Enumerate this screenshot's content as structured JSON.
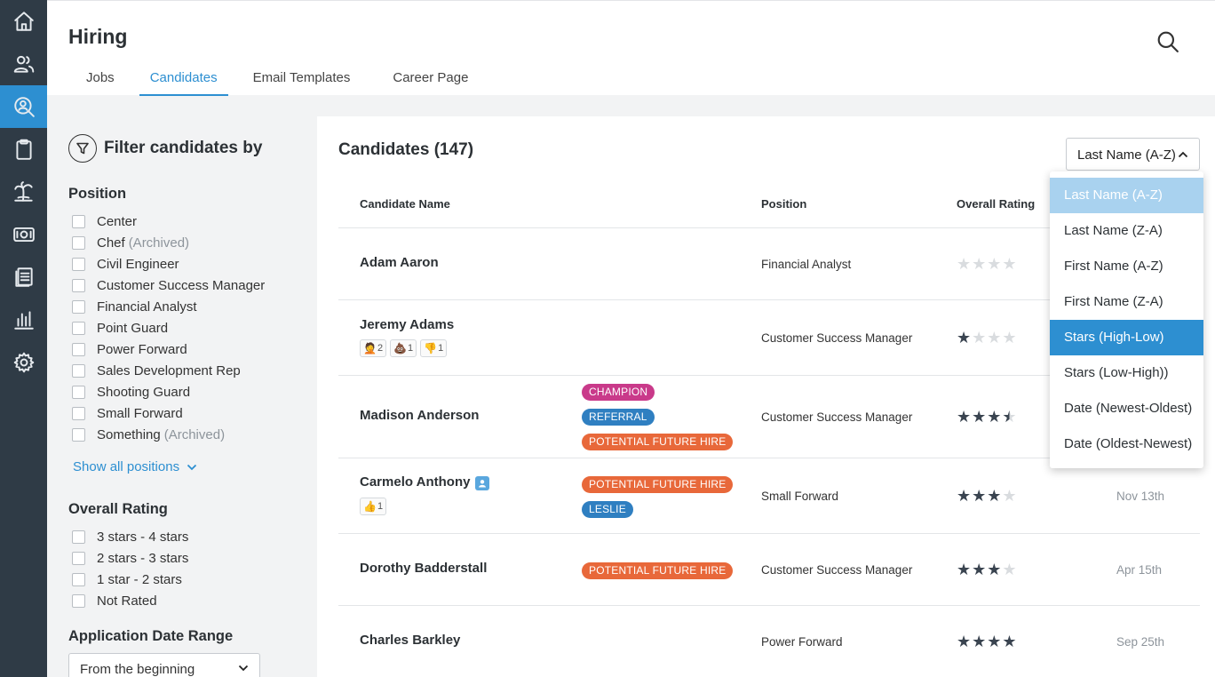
{
  "nav": {
    "items": [
      {
        "icon": "home-icon"
      },
      {
        "icon": "people-icon"
      },
      {
        "icon": "hiring-search-icon",
        "active": true
      },
      {
        "icon": "clipboard-icon"
      },
      {
        "icon": "palm-tree-icon"
      },
      {
        "icon": "money-icon"
      },
      {
        "icon": "documents-icon"
      },
      {
        "icon": "reports-chart-icon"
      },
      {
        "icon": "settings-gear-icon"
      }
    ]
  },
  "header": {
    "title": "Hiring",
    "tabs": [
      {
        "label": "Jobs"
      },
      {
        "label": "Candidates",
        "active": true
      },
      {
        "label": "Email Templates"
      },
      {
        "label": "Career Page"
      }
    ]
  },
  "filters": {
    "title": "Filter candidates by",
    "position": {
      "title": "Position",
      "options": [
        {
          "label": "Center",
          "note": ""
        },
        {
          "label": "Chef",
          "note": "(Archived)"
        },
        {
          "label": "Civil Engineer",
          "note": ""
        },
        {
          "label": "Customer Success Manager",
          "note": ""
        },
        {
          "label": "Financial Analyst",
          "note": ""
        },
        {
          "label": "Point Guard",
          "note": ""
        },
        {
          "label": "Power Forward",
          "note": ""
        },
        {
          "label": "Sales Development Rep",
          "note": ""
        },
        {
          "label": "Shooting Guard",
          "note": ""
        },
        {
          "label": "Small Forward",
          "note": ""
        },
        {
          "label": "Something",
          "note": "(Archived)"
        }
      ],
      "show_all": "Show all positions"
    },
    "rating": {
      "title": "Overall Rating",
      "options": [
        "3 stars - 4 stars",
        "2 stars - 3 stars",
        "1 star - 2 stars",
        "Not Rated"
      ]
    },
    "date_range": {
      "title": "Application Date Range",
      "value": "From the beginning"
    }
  },
  "main": {
    "title": "Candidates (147)",
    "sort_value": "Last Name (A-Z)",
    "columns": {
      "name": "Candidate Name",
      "position": "Position",
      "rating": "Overall Rating"
    },
    "rows": [
      {
        "name": "Adam Aaron",
        "position": "Financial Analyst",
        "stars": 0,
        "date": "",
        "tags": [],
        "reacts": []
      },
      {
        "name": "Jeremy Adams",
        "position": "Customer Success Manager",
        "stars": 1,
        "date": "",
        "tags": [],
        "reacts": [
          {
            "emoji": "🤦",
            "count": "2"
          },
          {
            "emoji": "💩",
            "count": "1"
          },
          {
            "emoji": "👎",
            "count": "1"
          }
        ]
      },
      {
        "name": "Madison Anderson",
        "position": "Customer Success Manager",
        "stars": 3.5,
        "date": "",
        "tags": [
          {
            "label": "CHAMPION",
            "color": "#c93a8a"
          },
          {
            "label": "REFERRAL",
            "color": "#2f7fc1"
          },
          {
            "label": "POTENTIAL FUTURE HIRE",
            "color": "#e8683a"
          }
        ],
        "reacts": []
      },
      {
        "name": "Carmelo Anthony",
        "position": "Small Forward",
        "stars": 3,
        "date": "Nov 13th",
        "tags": [
          {
            "label": "POTENTIAL FUTURE HIRE",
            "color": "#e8683a"
          },
          {
            "label": "LESLIE",
            "color": "#2f7fc1"
          }
        ],
        "reacts": [
          {
            "emoji": "👍",
            "count": "1"
          }
        ]
      },
      {
        "name": "Dorothy Badderstall",
        "position": "Customer Success Manager",
        "stars": 3,
        "date": "Apr 15th",
        "tags": [
          {
            "label": "POTENTIAL FUTURE HIRE",
            "color": "#e8683a"
          }
        ],
        "reacts": []
      },
      {
        "name": "Charles Barkley",
        "position": "Power Forward",
        "stars": 4,
        "date": "Sep 25th",
        "tags": [],
        "reacts": []
      }
    ]
  },
  "sort_menu": {
    "options": [
      {
        "label": "Last Name (A-Z)",
        "state": "current"
      },
      {
        "label": "Last Name (Z-A)",
        "state": ""
      },
      {
        "label": "First Name (A-Z)",
        "state": ""
      },
      {
        "label": "First Name (Z-A)",
        "state": ""
      },
      {
        "label": "Stars (High-Low)",
        "state": "hover"
      },
      {
        "label": "Stars (Low-High))",
        "state": ""
      },
      {
        "label": "Date (Newest-Oldest)",
        "state": ""
      },
      {
        "label": "Date (Oldest-Newest)",
        "state": ""
      }
    ]
  },
  "colors": {
    "accent": "#2d8fd1",
    "rail": "#2f3b46",
    "menu_current": "#a9d2ef"
  }
}
